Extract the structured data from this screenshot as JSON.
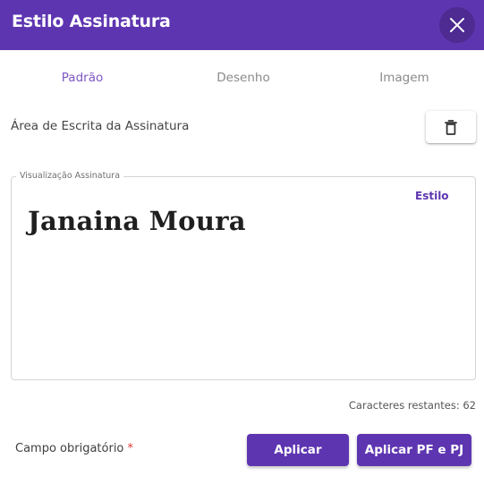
{
  "dialog": {
    "title": "Estilo Assinatura",
    "close_icon": "close-icon"
  },
  "tabs": [
    {
      "label": "Padrão",
      "active": true
    },
    {
      "label": "Desenho",
      "active": false
    },
    {
      "label": "Imagem",
      "active": false
    }
  ],
  "writing_area": {
    "label": "Área de Escrita da Assinatura",
    "clear_icon": "trash-icon"
  },
  "preview": {
    "legend": "Visualização Assinatura",
    "style_link": "Estilo",
    "signature": "Janaina Moura"
  },
  "chars_remaining": "Caracteres restantes: 62",
  "footer": {
    "required_label": "Campo obrigatório",
    "required_marker": "*",
    "apply_label": "Aplicar",
    "apply_pfpj_label": "Aplicar PF e PJ"
  },
  "colors": {
    "primary": "#5e35b1",
    "tab_active": "#7e57c2",
    "required": "#e53935"
  }
}
